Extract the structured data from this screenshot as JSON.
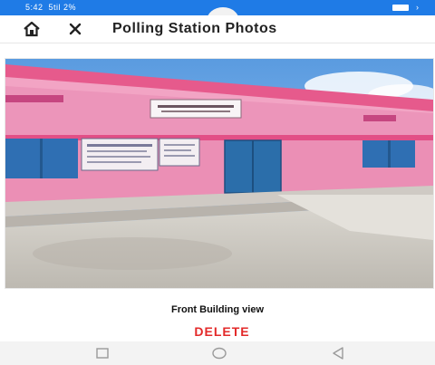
{
  "status_bar": {
    "time": "5:42",
    "network": "5til 2%",
    "arrow": "›"
  },
  "app_bar": {
    "title": "Polling Station Photos",
    "home_icon": "home-icon",
    "close_icon": "close-icon"
  },
  "photo": {
    "description_icon": "building-photo",
    "caption": "Front Building view"
  },
  "actions": {
    "delete_label": "DELETE"
  },
  "nav_bar": {
    "recent_icon": "square-icon",
    "home_icon": "circle-icon",
    "back_icon": "triangle-back-icon"
  },
  "colors": {
    "status_bar": "#1f7be6",
    "delete": "#e32a2a",
    "wall": "#e98bb1",
    "door": "#2b6eaa"
  }
}
